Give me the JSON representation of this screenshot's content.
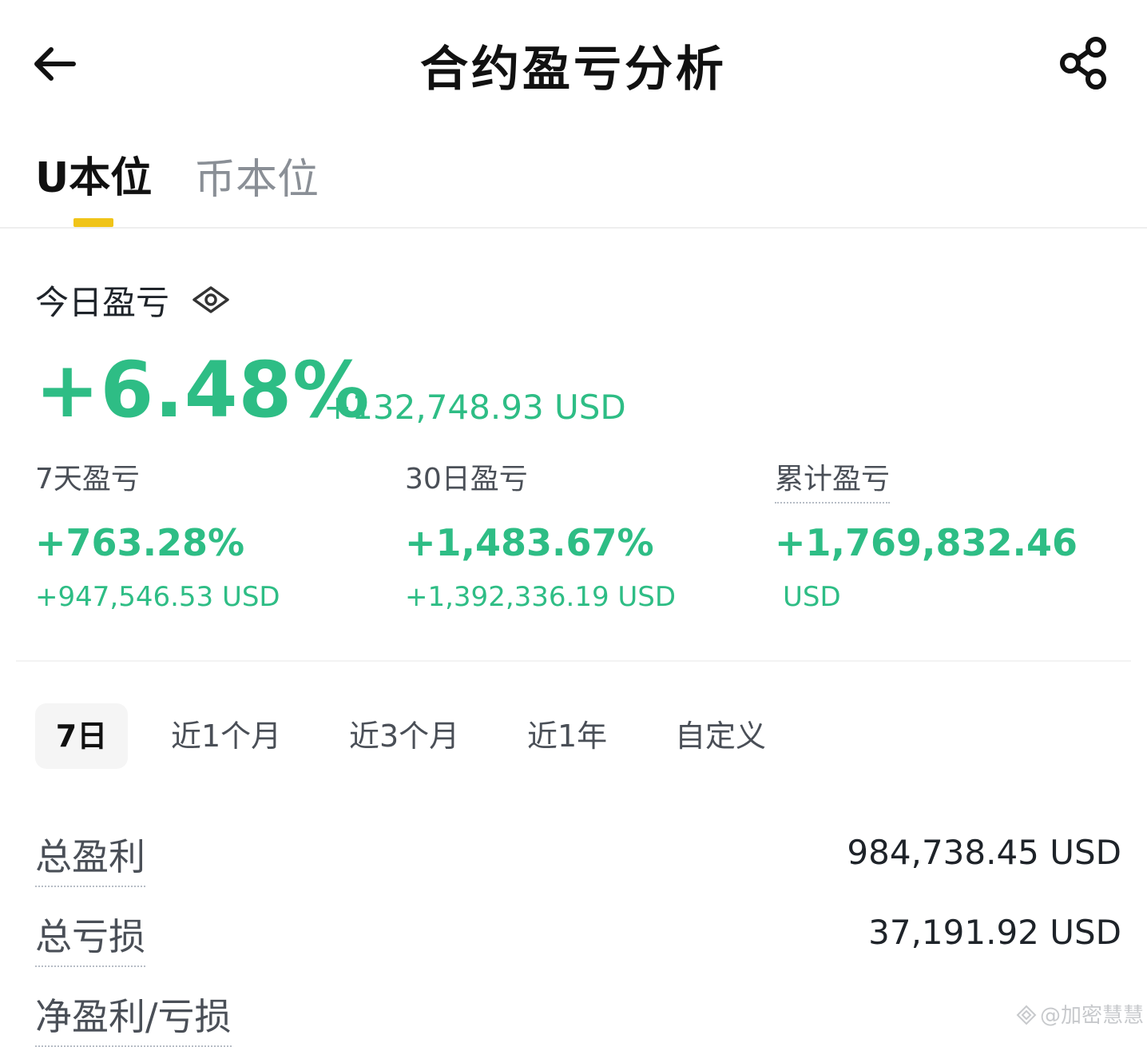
{
  "header": {
    "title": "合约盈亏分析"
  },
  "tabs": [
    {
      "label": "U本位",
      "active": true
    },
    {
      "label": "币本位",
      "active": false
    }
  ],
  "colors": {
    "accent": "#f0c419",
    "profit": "#2ebd85",
    "text_primary": "#1e2329",
    "text_secondary": "#4a4f57"
  },
  "today": {
    "label": "今日盈亏",
    "percent": "+6.48%",
    "usd": "+132,748.93 USD"
  },
  "stats": [
    {
      "label": "7天盈亏",
      "percent": "+763.28%",
      "usd": "+947,546.53 USD"
    },
    {
      "label": "30日盈亏",
      "percent": "+1,483.67%",
      "usd": "+1,392,336.19 USD"
    },
    {
      "label": "累计盈亏",
      "percent": "+1,769,832.46",
      "usd": "USD"
    }
  ],
  "periods": [
    {
      "label": "7日",
      "active": true
    },
    {
      "label": "近1个月",
      "active": false
    },
    {
      "label": "近3个月",
      "active": false
    },
    {
      "label": "近1年",
      "active": false
    },
    {
      "label": "自定义",
      "active": false
    }
  ],
  "summary": [
    {
      "label": "总盈利",
      "value": "984,738.45 USD"
    },
    {
      "label": "总亏损",
      "value": "37,191.92 USD"
    },
    {
      "label": "净盈利/亏损",
      "value": ""
    }
  ],
  "watermark": "@加密慧慧",
  "icons": {
    "back": "arrow-left-icon",
    "share": "share-icon",
    "eye": "eye-icon"
  }
}
